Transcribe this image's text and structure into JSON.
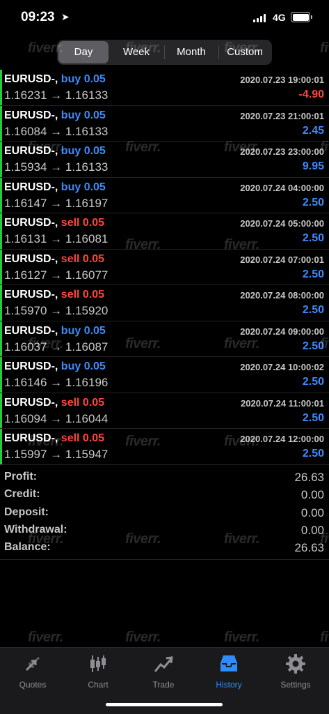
{
  "status": {
    "time": "09:23",
    "network": "4G"
  },
  "tabs": [
    {
      "label": "Day",
      "active": true
    },
    {
      "label": "Week",
      "active": false
    },
    {
      "label": "Month",
      "active": false
    },
    {
      "label": "Custom",
      "active": false
    }
  ],
  "deals": [
    {
      "symbol": "EURUSD-,",
      "type": "buy",
      "volume": "buy 0.05",
      "date": "2020.07.23 19:00:01",
      "price": "1.16231 → 1.16133",
      "profit": "-4.90"
    },
    {
      "symbol": "EURUSD-,",
      "type": "buy",
      "volume": "buy 0.05",
      "date": "2020.07.23 21:00:01",
      "price": "1.16084 → 1.16133",
      "profit": "2.45"
    },
    {
      "symbol": "EURUSD-,",
      "type": "buy",
      "volume": "buy 0.05",
      "date": "2020.07.23 23:00:00",
      "price": "1.15934 → 1.16133",
      "profit": "9.95"
    },
    {
      "symbol": "EURUSD-,",
      "type": "buy",
      "volume": "buy 0.05",
      "date": "2020.07.24 04:00:00",
      "price": "1.16147 → 1.16197",
      "profit": "2.50"
    },
    {
      "symbol": "EURUSD-,",
      "type": "sell",
      "volume": "sell 0.05",
      "date": "2020.07.24 05:00:00",
      "price": "1.16131 → 1.16081",
      "profit": "2.50"
    },
    {
      "symbol": "EURUSD-,",
      "type": "sell",
      "volume": "sell 0.05",
      "date": "2020.07.24 07:00:01",
      "price": "1.16127 → 1.16077",
      "profit": "2.50"
    },
    {
      "symbol": "EURUSD-,",
      "type": "sell",
      "volume": "sell 0.05",
      "date": "2020.07.24 08:00:00",
      "price": "1.15970 → 1.15920",
      "profit": "2.50"
    },
    {
      "symbol": "EURUSD-,",
      "type": "buy",
      "volume": "buy 0.05",
      "date": "2020.07.24 09:00:00",
      "price": "1.16037 → 1.16087",
      "profit": "2.50"
    },
    {
      "symbol": "EURUSD-,",
      "type": "buy",
      "volume": "buy 0.05",
      "date": "2020.07.24 10:00:02",
      "price": "1.16146 → 1.16196",
      "profit": "2.50"
    },
    {
      "symbol": "EURUSD-,",
      "type": "sell",
      "volume": "sell 0.05",
      "date": "2020.07.24 11:00:01",
      "price": "1.16094 → 1.16044",
      "profit": "2.50"
    },
    {
      "symbol": "EURUSD-,",
      "type": "sell",
      "volume": "sell 0.05",
      "date": "2020.07.24 12:00:00",
      "price": "1.15997 → 1.15947",
      "profit": "2.50"
    }
  ],
  "summary": [
    {
      "label": "Profit:",
      "value": "26.63"
    },
    {
      "label": "Credit:",
      "value": "0.00"
    },
    {
      "label": "Deposit:",
      "value": "0.00"
    },
    {
      "label": "Withdrawal:",
      "value": "0.00"
    },
    {
      "label": "Balance:",
      "value": "26.63"
    }
  ],
  "watermark": "fiverr.",
  "bottom_nav": [
    {
      "label": "Quotes",
      "icon": "quotes-icon",
      "active": false
    },
    {
      "label": "Chart",
      "icon": "chart-icon",
      "active": false
    },
    {
      "label": "Trade",
      "icon": "trade-icon",
      "active": false
    },
    {
      "label": "History",
      "icon": "history-icon",
      "active": true
    },
    {
      "label": "Settings",
      "icon": "gear-icon",
      "active": false
    }
  ],
  "colors": {
    "buy": "#3d8bfd",
    "sell": "#ff453a",
    "accent": "#2f8cff",
    "profit_pos": "#3d8bfd",
    "profit_neg": "#ff453a",
    "bar": "#27c93f"
  }
}
